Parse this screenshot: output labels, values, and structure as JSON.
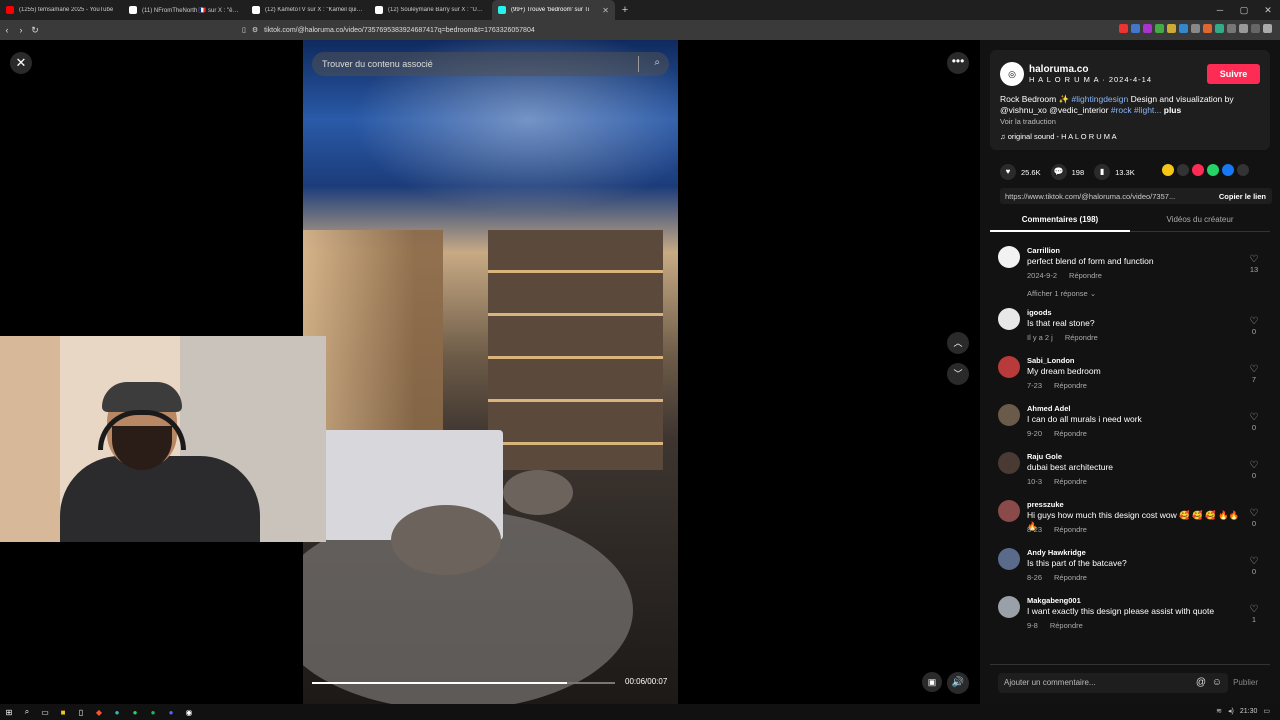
{
  "browser": {
    "tabs": [
      {
        "label": "(1255) temsamane 2025 - YouTube",
        "color": "#ff0000",
        "active": false
      },
      {
        "label": "(11) NFromTheNorth 🇫🇷 sur X : \"être c",
        "color": "#ffffff",
        "active": false
      },
      {
        "label": "(12) KametoTV sur X : \"Kameil qui rac",
        "color": "#ffffff",
        "active": false
      },
      {
        "label": "(12) Souleymane Barry sur X : \"Un ho",
        "color": "#ffffff",
        "active": false
      },
      {
        "label": "(99+) Trouve 'bedroom' sur Ti",
        "color": "#25f4ee",
        "active": true
      }
    ],
    "new_tab": "+",
    "url": "tiktok.com/@haloruma.co/video/7357695383924687417q=bedroom&t=1763326057804",
    "nav": {
      "back": "‹",
      "forward": "›",
      "reload": "↻"
    },
    "window": {
      "min": "─",
      "max": "▢",
      "close": "✕"
    }
  },
  "video": {
    "close_icon": "✕",
    "search_placeholder": "Trouver du contenu associé",
    "search_icon": "⌕",
    "progress": 0.84,
    "time": "00:06/00:07",
    "more": "•••",
    "up": "︿",
    "down": "﹀",
    "cc": "▣",
    "volume": "🔊"
  },
  "post": {
    "avatar_text": "◎",
    "username": "haloruma.co",
    "meta": "H A L O R U M A · 2024-4-14",
    "follow": "Suivre",
    "desc_start": "Rock Bedroom ✨ ",
    "tag1": "#lightingdesign",
    "desc_mid": " Design and visualization by @vishnu_xo @vedic_interior ",
    "tag2": "#rock",
    "tag3": " #light...",
    "desc_more": " plus",
    "translate": "Voir la traduction",
    "sound": "♫ original sound - H A L O R U M A",
    "likes": "25.6K",
    "comments": "198",
    "saves": "13.3K",
    "link": "https://www.tiktok.com/@haloruma.co/video/7357...",
    "copy": "Copier le lien",
    "tab_comments": "Commentaires (198)",
    "tab_creator": "Vidéos du créateur"
  },
  "comments": [
    {
      "name": "Carrillion",
      "text": "perfect blend of form and function",
      "date": "2024-9-2",
      "reply": "Répondre",
      "likes": "13",
      "avatar": "#f2f2f2",
      "replies": "Afficher 1 réponse ⌄"
    },
    {
      "name": "igoods",
      "text": "Is that real stone?",
      "date": "Il y a 2 j",
      "reply": "Répondre",
      "likes": "0",
      "avatar": "#e8e8e8",
      "replies": ""
    },
    {
      "name": "Sabi_London",
      "text": "My dream bedroom",
      "date": "7-23",
      "reply": "Répondre",
      "likes": "7",
      "avatar": "#b83a3a",
      "replies": ""
    },
    {
      "name": "Ahmed Adel",
      "text": "I can do all murals i need work",
      "date": "9-20",
      "reply": "Répondre",
      "likes": "0",
      "avatar": "#6a5a4a",
      "replies": ""
    },
    {
      "name": "Raju Gole",
      "text": "dubai best architecture",
      "date": "10-3",
      "reply": "Répondre",
      "likes": "0",
      "avatar": "#4a3a34",
      "replies": ""
    },
    {
      "name": "presszuke",
      "text": "Hi guys how much this design cost wow 🥰 🥰 🥰 🔥🔥🔥",
      "date": "8-23",
      "reply": "Répondre",
      "likes": "0",
      "avatar": "#8a4a4a",
      "replies": ""
    },
    {
      "name": "Andy Hawkridge",
      "text": "Is this part of the batcave?",
      "date": "8-26",
      "reply": "Répondre",
      "likes": "0",
      "avatar": "#5a6a8a",
      "replies": ""
    },
    {
      "name": "Makgabeng001",
      "text": "I want exactly this design please assist with quote",
      "date": "9-8",
      "reply": "Répondre",
      "likes": "1",
      "avatar": "#9aa0a8",
      "replies": ""
    }
  ],
  "input": {
    "placeholder": "Ajouter un commentaire...",
    "at": "@",
    "emoji": "☺",
    "publish": "Publier"
  },
  "taskbar": {
    "time": "21:30"
  }
}
